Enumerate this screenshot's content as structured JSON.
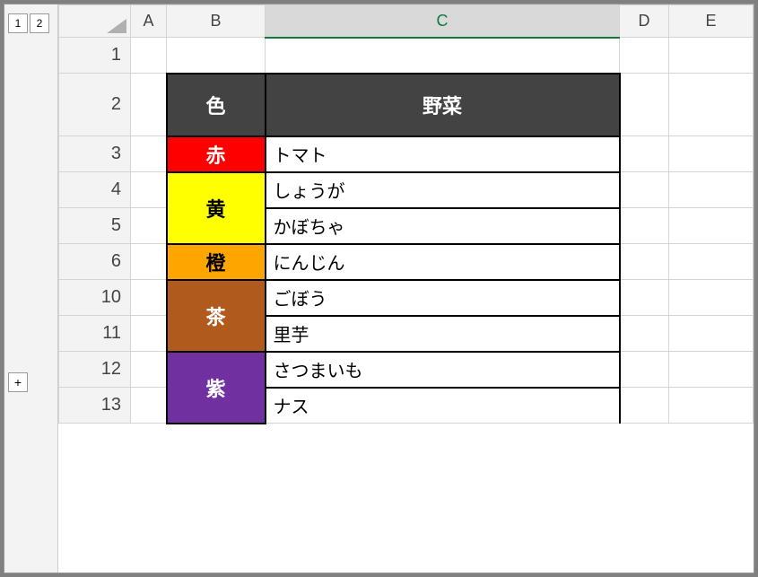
{
  "outline": {
    "level_buttons": [
      "1",
      "2"
    ],
    "expand_button": "+"
  },
  "columns": [
    "A",
    "B",
    "C",
    "D",
    "E"
  ],
  "selected_column": "C",
  "row_numbers": [
    "1",
    "2",
    "3",
    "4",
    "5",
    "6",
    "10",
    "11",
    "12",
    "13"
  ],
  "table": {
    "header_color": "色",
    "header_veg": "野菜",
    "rows": [
      {
        "color_label": "赤",
        "fill": "c-red",
        "text_class": "",
        "veg": "トマト",
        "rowspan": 1
      },
      {
        "color_label": "黄",
        "fill": "c-yellow",
        "text_class": "blacktext",
        "veg": "しょうが",
        "rowspan": 2
      },
      {
        "veg": "かぼちゃ"
      },
      {
        "color_label": "橙",
        "fill": "c-orange",
        "text_class": "blacktext",
        "veg": "にんじん",
        "rowspan": 1
      },
      {
        "color_label": "茶",
        "fill": "c-brown",
        "text_class": "",
        "veg": "ごぼう",
        "rowspan": 2
      },
      {
        "veg": "里芋"
      },
      {
        "color_label": "紫",
        "fill": "c-purple",
        "text_class": "",
        "veg": "さつまいも",
        "rowspan": 2
      },
      {
        "veg": "ナス"
      }
    ]
  }
}
